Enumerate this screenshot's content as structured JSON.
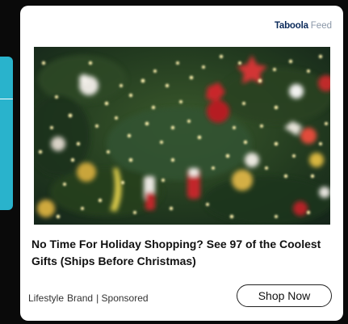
{
  "ad": {
    "brand_name": "Taboola",
    "brand_feed": "Feed",
    "image_alt": "Decorated Christmas tree with glowing lights and ornaments",
    "headline": "No Time For Holiday Shopping? See 97 of the Coolest Gifts (Ships Before Christmas)",
    "meta": {
      "category": "Lifestyle",
      "advertiser": "Brand",
      "sponsored": "| Sponsored"
    },
    "cta_label": "Shop Now"
  },
  "colors": {
    "accent_panel": "#29b3cc",
    "brand_text": "#0b2a5a",
    "card_background": "#ffffff"
  }
}
